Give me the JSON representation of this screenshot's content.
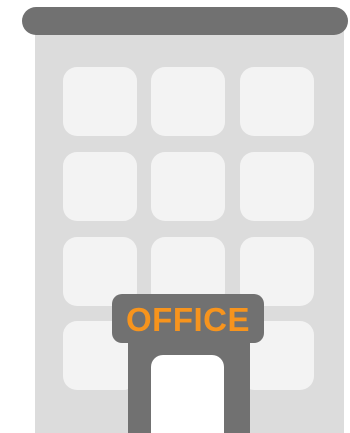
{
  "illustration": {
    "name": "office-building",
    "sign_text": "OFFICE",
    "colors": {
      "roof": "#717171",
      "facade": "#dcdcdc",
      "window": "#f3f3f3",
      "door_frame": "#717171",
      "sign_background": "#717171",
      "sign_text": "#f7941d",
      "background": "#ffffff"
    }
  }
}
